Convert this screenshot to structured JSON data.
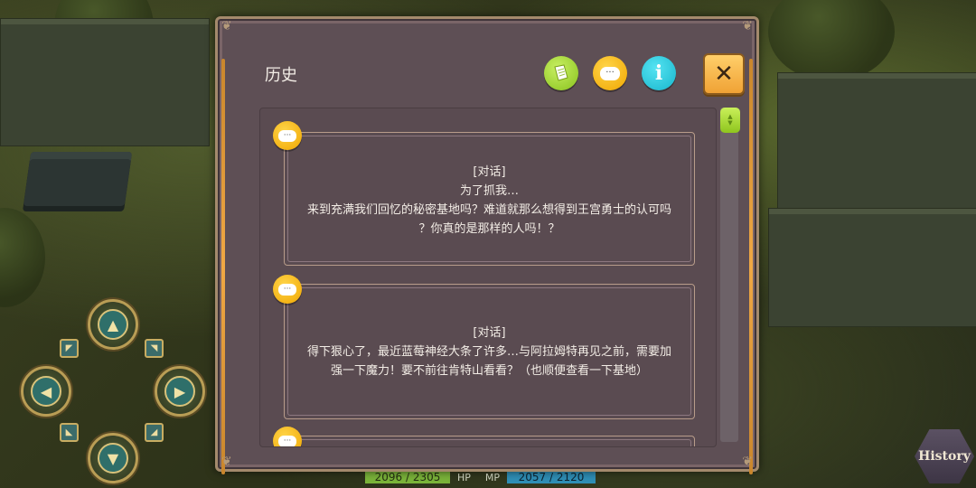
{
  "panel": {
    "title": "历史",
    "buttons": {
      "quest_icon": "quest-scroll-icon",
      "chat_icon": "chat-bubble-icon",
      "info_label": "i",
      "close_label": "✕"
    },
    "entries": [
      {
        "tag": "[对话]",
        "lines": [
          "为了抓我…",
          "来到充满我们回忆的秘密基地吗？难道就那么想得到王宫勇士的认可吗",
          "？你真的是那样的人吗！？"
        ]
      },
      {
        "tag": "[对话]",
        "lines": [
          "得下狠心了，最近蓝莓神经大条了许多…与阿拉姆特再见之前，需要加",
          "强一下魔力！要不前往肯特山看看？（也顺便查看一下基地）"
        ]
      }
    ]
  },
  "hud": {
    "hp_value": "2096 / 2305",
    "hp_label": "HP",
    "mp_label": "MP",
    "mp_value": "2057 / 2120",
    "history_label": "History"
  },
  "colors": {
    "panel_bg": "#5e4f55",
    "accent_gold": "#f0a844",
    "hp_green": "#7bb43a",
    "mp_blue": "#2f8fb6"
  }
}
